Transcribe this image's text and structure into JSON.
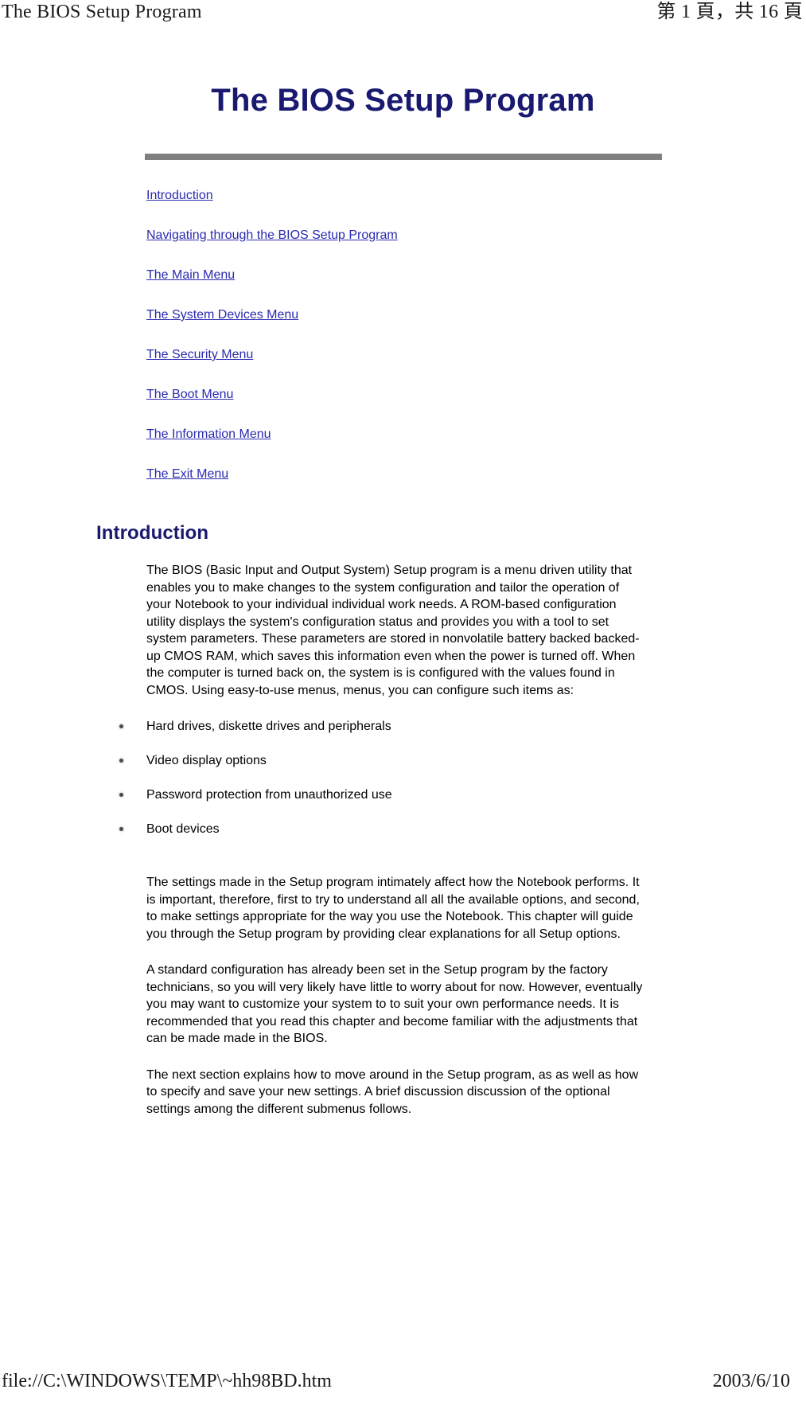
{
  "print_header": {
    "left": "The BIOS Setup Program",
    "right": "第 1 頁，共 16 頁"
  },
  "print_footer": {
    "left": "file://C:\\WINDOWS\\TEMP\\~hh98BD.htm",
    "right": "2003/6/10"
  },
  "document": {
    "title": "The BIOS Setup Program",
    "divider_color": "#808080",
    "title_color": "#191970",
    "link_color": "#2a2ab0",
    "toc": [
      {
        "label": "Introduction"
      },
      {
        "label": "Navigating through the BIOS Setup Program"
      },
      {
        "label": "The Main Menu"
      },
      {
        "label": "The System Devices Menu"
      },
      {
        "label": "The Security Menu"
      },
      {
        "label": "The Boot Menu"
      },
      {
        "label": "The Information Menu"
      },
      {
        "label": "The Exit Menu"
      }
    ],
    "section": {
      "heading": "Introduction",
      "paragraph_1": "The BIOS (Basic Input and Output System) Setup program is a menu driven utility that enables you to make changes to the system configuration and tailor the operation of your Notebook to your individual individual work needs. A ROM-based configuration utility displays the system's configuration status and provides you with a tool to set system parameters. These parameters are stored in nonvolatile battery backed backed-up CMOS RAM, which saves this information even when the power is turned off. When the computer is turned back on, the system is is configured with the values found in CMOS. Using easy-to-use menus, menus, you can configure such items as:",
      "bullets": [
        {
          "label": "Hard drives, diskette drives and peripherals"
        },
        {
          "label": "Video display options"
        },
        {
          "label": "Password protection from unauthorized use"
        },
        {
          "label": "Boot devices"
        }
      ],
      "paragraph_2": "The settings made in the Setup program intimately affect how the Notebook performs. It is important, therefore, first to try to understand all all the available options, and second, to make settings appropriate for the way you use the Notebook. This chapter will guide you through the Setup program by providing clear explanations for all Setup options.",
      "paragraph_3": "A standard configuration has already been set in the Setup program by the factory technicians, so you will very likely have little to worry about for now. However, eventually you may want to customize your system to to suit your own performance needs. It is recommended that you read this chapter and become familiar with the adjustments that can be made made in the BIOS.",
      "paragraph_4": "The next section explains how to move around in the Setup program, as as well as how to specify and save your new settings. A brief discussion discussion of the optional settings among the different submenus follows."
    }
  }
}
